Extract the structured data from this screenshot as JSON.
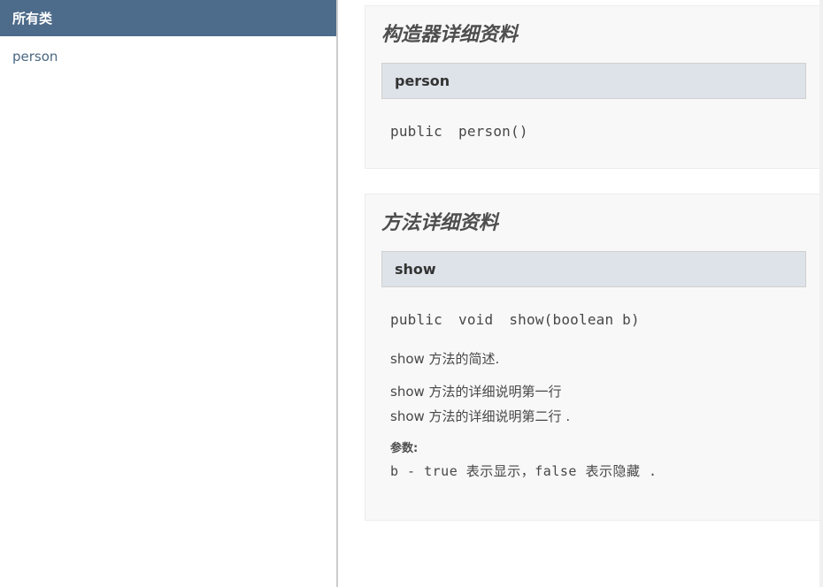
{
  "sidebar": {
    "heading": "所有类",
    "classes": [
      "person"
    ]
  },
  "constructor_section": {
    "heading": "构造器详细资料",
    "name": "person",
    "signature": {
      "modifier": "public",
      "nameCall": "person()"
    }
  },
  "method_section": {
    "heading": "方法详细资料",
    "name": "show",
    "signature": {
      "modifier": "public",
      "returnType": "void",
      "nameCall": "show(boolean  b)"
    },
    "summary": {
      "m": "show",
      "t": " 方法的简述."
    },
    "details": [
      {
        "m": "show",
        "t": " 方法的详细说明第一行"
      },
      {
        "m": "show",
        "t": " 方法的详细说明第二行 ."
      }
    ],
    "param_label": "参数:",
    "param_line": "b - true 表示显示，false 表示隐藏 ."
  }
}
